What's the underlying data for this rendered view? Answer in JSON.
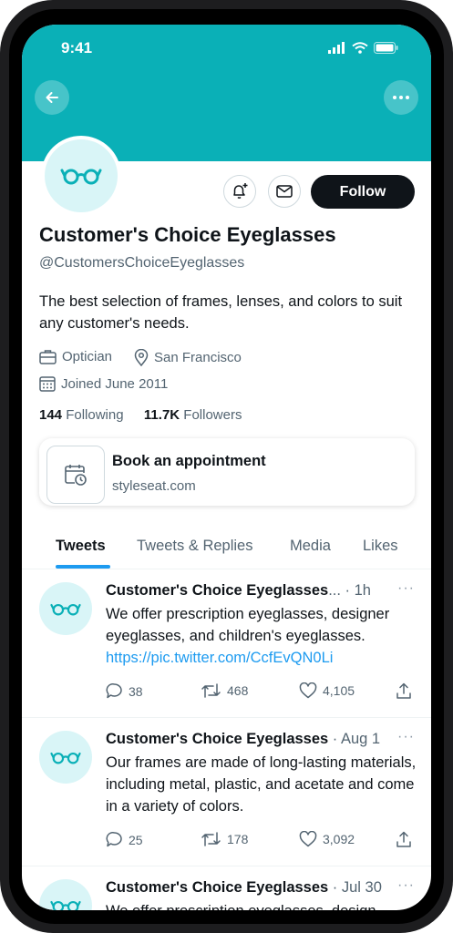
{
  "status_bar": {
    "time": "9:41"
  },
  "profile": {
    "name": "Customer's Choice Eyeglasses",
    "handle": "@CustomersChoiceEyeglasses",
    "bio": "The best selection of frames, lenses, and colors to suit any customer's needs.",
    "category": "Optician",
    "location": "San Francisco",
    "joined": "Joined June 2011",
    "following_count": "144",
    "following_label": "Following",
    "followers_count": "11.7K",
    "followers_label": "Followers",
    "follow_label": "Follow"
  },
  "card": {
    "title": "Book an appointment",
    "subtitle": "styleseat.com"
  },
  "tabs": [
    {
      "label": "Tweets",
      "active": true
    },
    {
      "label": "Tweets & Replies"
    },
    {
      "label": "Media"
    },
    {
      "label": "Likes"
    }
  ],
  "tweets": [
    {
      "name": "Customer's Choice Eyeglasses",
      "truncation": "...",
      "meta": " · 1h",
      "text": "We offer prescription eyeglasses, designer eyeglasses, and children's eyeglasses.",
      "link": "https://pic.twitter.com/CcfEvQN0Li",
      "replies": "38",
      "retweets": "468",
      "likes": "4,105"
    },
    {
      "name": "Customer's Choice Eyeglasses",
      "meta": " · Aug 1",
      "text": "Our frames are made of long-lasting materials, including metal, plastic, and acetate and come in a variety of colors.",
      "replies": "25",
      "retweets": "178",
      "likes": "3,092"
    },
    {
      "name": "Customer's Choice Eyeglasses",
      "meta": " · Jul 30",
      "text": "We offer prescription eyeglasses, design"
    }
  ],
  "colors": {
    "header": "#0ab0b7",
    "accent": "#1d9bf0",
    "glasses": "#0ab0b7"
  },
  "icons": [
    "back-arrow-icon",
    "more-icon",
    "glasses-icon",
    "notification-bell-icon",
    "mail-icon",
    "briefcase-icon",
    "location-pin-icon",
    "calendar-icon",
    "calendar-clock-icon",
    "reply-icon",
    "retweet-icon",
    "like-icon",
    "share-icon"
  ]
}
